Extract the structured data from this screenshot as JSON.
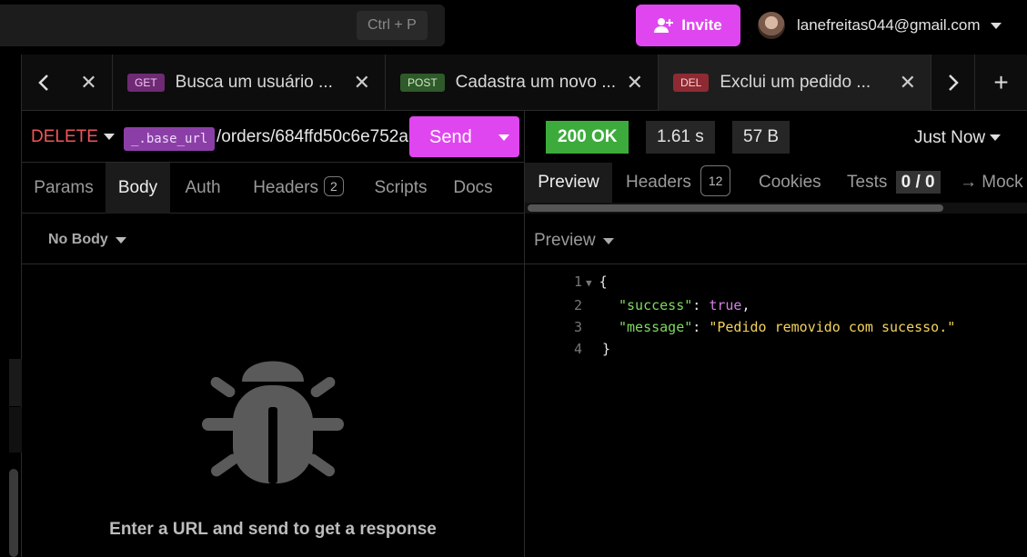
{
  "topbar": {
    "shortcut": "Ctrl + P",
    "invite_label": "Invite",
    "user_email": "lanefreitas044@gmail.com"
  },
  "tabs": [
    {
      "method": "GET",
      "title": "Busca um usuário ...",
      "badge_bg": "#6e2a73",
      "badge_fg": "#f1c8f5"
    },
    {
      "method": "POST",
      "title": "Cadastra um novo ...",
      "badge_bg": "#2f5a2a",
      "badge_fg": "#cfe8c6"
    },
    {
      "method": "DEL",
      "title": "Exclui um pedido ...",
      "badge_bg": "#8e2a32",
      "badge_fg": "#ffd0d3"
    }
  ],
  "request": {
    "method": "DELETE",
    "base_url": "_.base_url",
    "url": "/orders/684ffd50c6e752a",
    "send_label": "Send"
  },
  "response": {
    "status": "200 OK",
    "time": "1.61 s",
    "size": "57 B",
    "when": "Just Now"
  },
  "request_tabs": {
    "params": "Params",
    "body": "Body",
    "auth": "Auth",
    "headers": "Headers",
    "headers_count": "2",
    "scripts": "Scripts",
    "docs": "Docs"
  },
  "response_tabs": {
    "preview": "Preview",
    "headers": "Headers",
    "headers_count": "12",
    "cookies": "Cookies",
    "tests": "Tests",
    "tests_count": "0 / 0",
    "mock": "→ Mock"
  },
  "body_panel": {
    "no_body": "No Body",
    "empty_message": "Enter a URL and send to get a response"
  },
  "preview_panel": {
    "label": "Preview",
    "lines": [
      "1",
      "2",
      "3",
      "4"
    ],
    "success_key": "\"success\"",
    "success_val": "true",
    "message_key": "\"message\"",
    "message_val": "\"Pedido removido com sucesso.\""
  },
  "colors": {
    "accent": "#e046ef",
    "status_ok": "#3cab3c",
    "method_delete": "#f1545a"
  }
}
